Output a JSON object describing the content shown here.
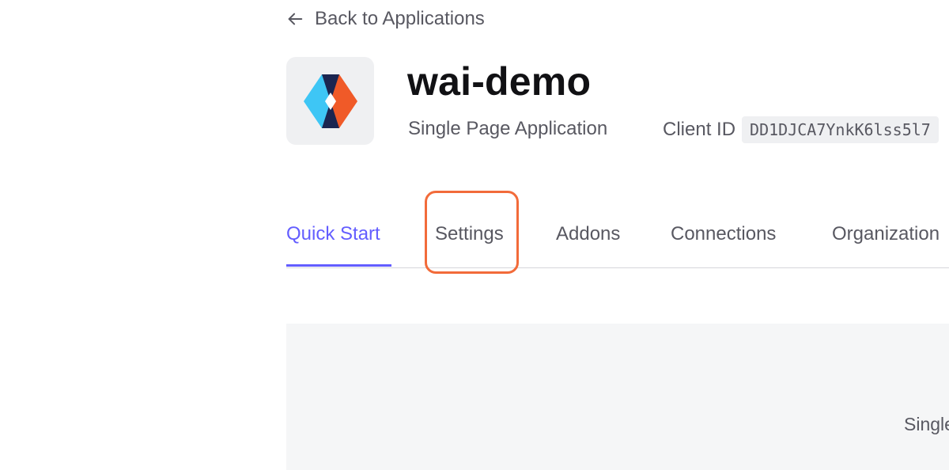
{
  "nav": {
    "back_label": "Back to Applications",
    "back_icon": "arrow-left-icon"
  },
  "app": {
    "name": "wai-demo",
    "type": "Single Page Application",
    "logo_icon": "app-logo-icon",
    "client_id_label": "Client ID",
    "client_id_value": "DD1DJCA7YnkK6lss5l7"
  },
  "tabs": [
    {
      "label": "Quick Start",
      "active": true
    },
    {
      "label": "Settings",
      "active": false
    },
    {
      "label": "Addons",
      "active": false
    },
    {
      "label": "Connections",
      "active": false
    },
    {
      "label": "Organization",
      "active": false
    }
  ],
  "panel": {
    "text": "Single"
  },
  "colors": {
    "accent": "#635dff",
    "highlight": "#f26b3a",
    "logo_blue": "#3ec6f5",
    "logo_orange": "#f05a28",
    "logo_navy": "#1b2550"
  }
}
